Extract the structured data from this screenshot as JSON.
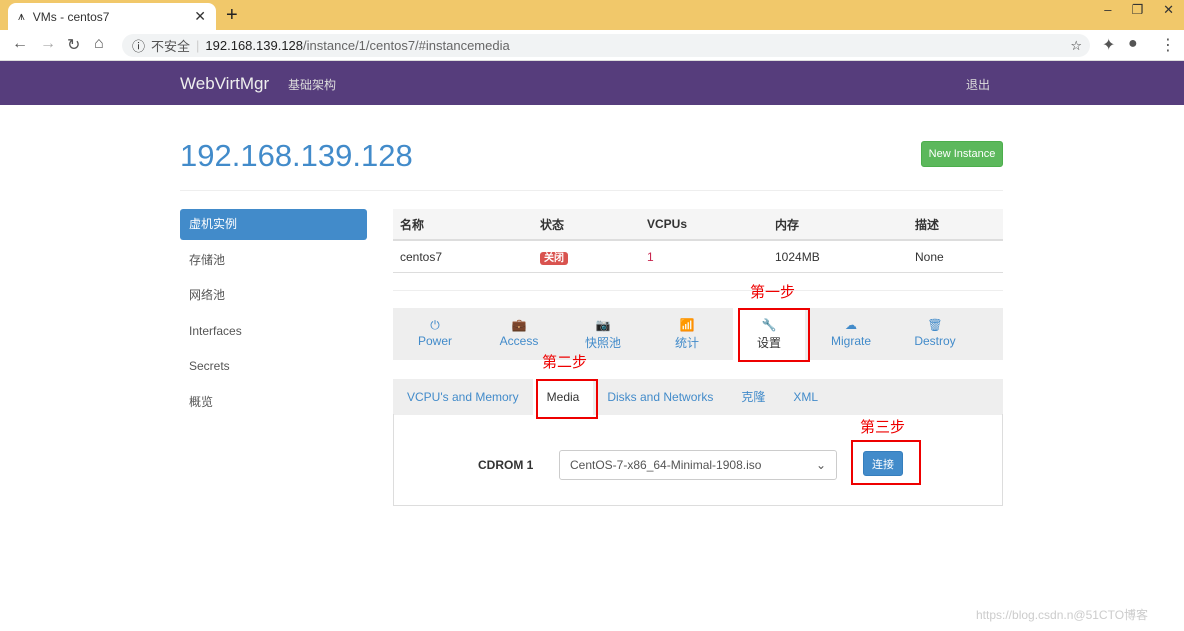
{
  "browser": {
    "tab_title": "VMs - centos7",
    "insecure_label": "不安全",
    "url_host": "192.168.139.128",
    "url_path": "/instance/1/centos7/#instancemedia"
  },
  "navbar": {
    "brand": "WebVirtMgr",
    "infra": "基础架构",
    "logout": "退出"
  },
  "page": {
    "title": "192.168.139.128",
    "new_instance": "New Instance"
  },
  "sidebar": {
    "items": [
      {
        "label": "虚机实例",
        "active": true
      },
      {
        "label": "存储池"
      },
      {
        "label": "网络池"
      },
      {
        "label": "Interfaces"
      },
      {
        "label": "Secrets"
      },
      {
        "label": "概览"
      }
    ]
  },
  "table": {
    "headers": [
      "名称",
      "状态",
      "VCPUs",
      "内存",
      "描述"
    ],
    "rows": [
      [
        "centos7",
        "关闭",
        "1",
        "1024MB",
        "None"
      ]
    ]
  },
  "actions": [
    {
      "label": "Power",
      "icon": "⏻"
    },
    {
      "label": "Access",
      "icon": "💼"
    },
    {
      "label": "快照池",
      "icon": "📷"
    },
    {
      "label": "统计",
      "icon": "📶"
    },
    {
      "label": "设置",
      "icon": "🔧",
      "active": true
    },
    {
      "label": "Migrate",
      "icon": "☁"
    },
    {
      "label": "Destroy",
      "icon": "🗑"
    }
  ],
  "subtabs": [
    {
      "label": "VCPU's and Memory"
    },
    {
      "label": "Media",
      "active": true
    },
    {
      "label": "Disks and Networks"
    },
    {
      "label": "克隆"
    },
    {
      "label": "XML"
    }
  ],
  "media": {
    "label": "CDROM 1",
    "selected": "CentOS-7-x86_64-Minimal-1908.iso",
    "connect": "连接"
  },
  "annotations": {
    "step1": "第一步",
    "step2": "第二步",
    "step3": "第三步"
  },
  "watermark": "https://blog.csdn.n@51CTO博客",
  "colors": {
    "navbar": "#563d7c",
    "primary": "#428bca",
    "success": "#5cb85c",
    "danger": "#d9534f",
    "annotation": "#ee0000"
  }
}
